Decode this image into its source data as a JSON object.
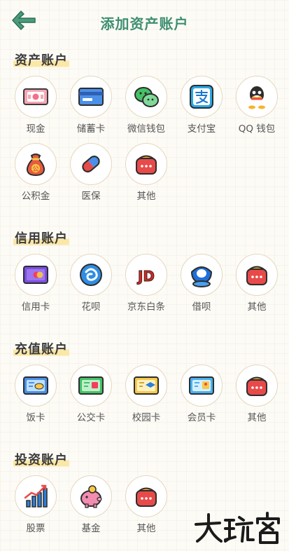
{
  "header": {
    "title": "添加资产账户",
    "back_icon": "back-arrow-icon",
    "accent_color": "#3e8f72"
  },
  "sections": [
    {
      "title": "资产账户",
      "items": [
        {
          "label": "现金",
          "icon": "cash-icon"
        },
        {
          "label": "储蓄卡",
          "icon": "debit-card-icon"
        },
        {
          "label": "微信钱包",
          "icon": "wechat-icon"
        },
        {
          "label": "支付宝",
          "icon": "alipay-icon"
        },
        {
          "label": "QQ 钱包",
          "icon": "qq-icon"
        },
        {
          "label": "公积金",
          "icon": "fund-bag-icon",
          "badge": "公"
        },
        {
          "label": "医保",
          "icon": "medicine-pill-icon"
        },
        {
          "label": "其他",
          "icon": "other-wallet-icon"
        }
      ]
    },
    {
      "title": "信用账户",
      "items": [
        {
          "label": "信用卡",
          "icon": "credit-card-icon"
        },
        {
          "label": "花呗",
          "icon": "huabei-icon"
        },
        {
          "label": "京东白条",
          "icon": "jd-icon",
          "badge": "JD"
        },
        {
          "label": "借呗",
          "icon": "jiebei-icon"
        },
        {
          "label": "其他",
          "icon": "other-wallet-icon"
        }
      ]
    },
    {
      "title": "充值账户",
      "items": [
        {
          "label": "饭卡",
          "icon": "meal-card-icon"
        },
        {
          "label": "公交卡",
          "icon": "bus-card-icon"
        },
        {
          "label": "校园卡",
          "icon": "campus-card-icon"
        },
        {
          "label": "会员卡",
          "icon": "member-card-icon"
        },
        {
          "label": "其他",
          "icon": "other-wallet-icon"
        }
      ]
    },
    {
      "title": "投资账户",
      "items": [
        {
          "label": "股票",
          "icon": "stock-chart-icon"
        },
        {
          "label": "基金",
          "icon": "piggy-bank-icon"
        },
        {
          "label": "其他",
          "icon": "other-wallet-icon"
        }
      ]
    }
  ],
  "watermark": {
    "text": "大玩客"
  }
}
